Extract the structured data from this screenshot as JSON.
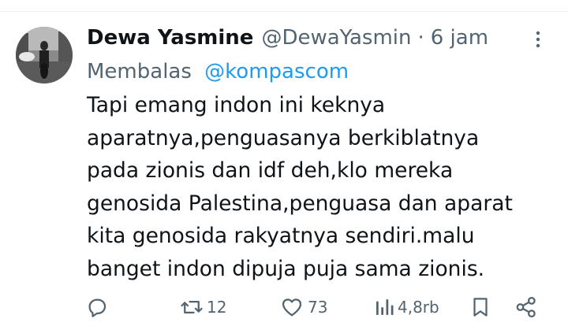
{
  "tweet": {
    "display_name": "Dewa Yasmine",
    "handle": "@DewaYasmin",
    "separator": "·",
    "time": "6 jam",
    "reply_prefix": "Membalas",
    "reply_to": "@kompascom",
    "text_lines": [
      "Tapi emang indon ini keknya",
      "aparatnya,penguasanya berkiblatnya",
      "pada zionis dan idf deh,klo mereka",
      "genosida Palestina,penguasa dan aparat",
      "kita genosida rakyatnya sendiri.malu",
      "banget indon dipuja puja sama zionis."
    ]
  },
  "actions": {
    "reply": {
      "icon": "comment-icon"
    },
    "repost": {
      "icon": "repost-icon",
      "count": "12"
    },
    "like": {
      "icon": "heart-icon",
      "count": "73"
    },
    "views": {
      "icon": "views-icon",
      "count": "4,8rb"
    },
    "bookmark": {
      "icon": "bookmark-icon"
    },
    "share": {
      "icon": "share-icon"
    }
  },
  "colors": {
    "text": "#0f1419",
    "secondary": "#536471",
    "link": "#1d9bf0",
    "divider": "#eff3f4"
  }
}
